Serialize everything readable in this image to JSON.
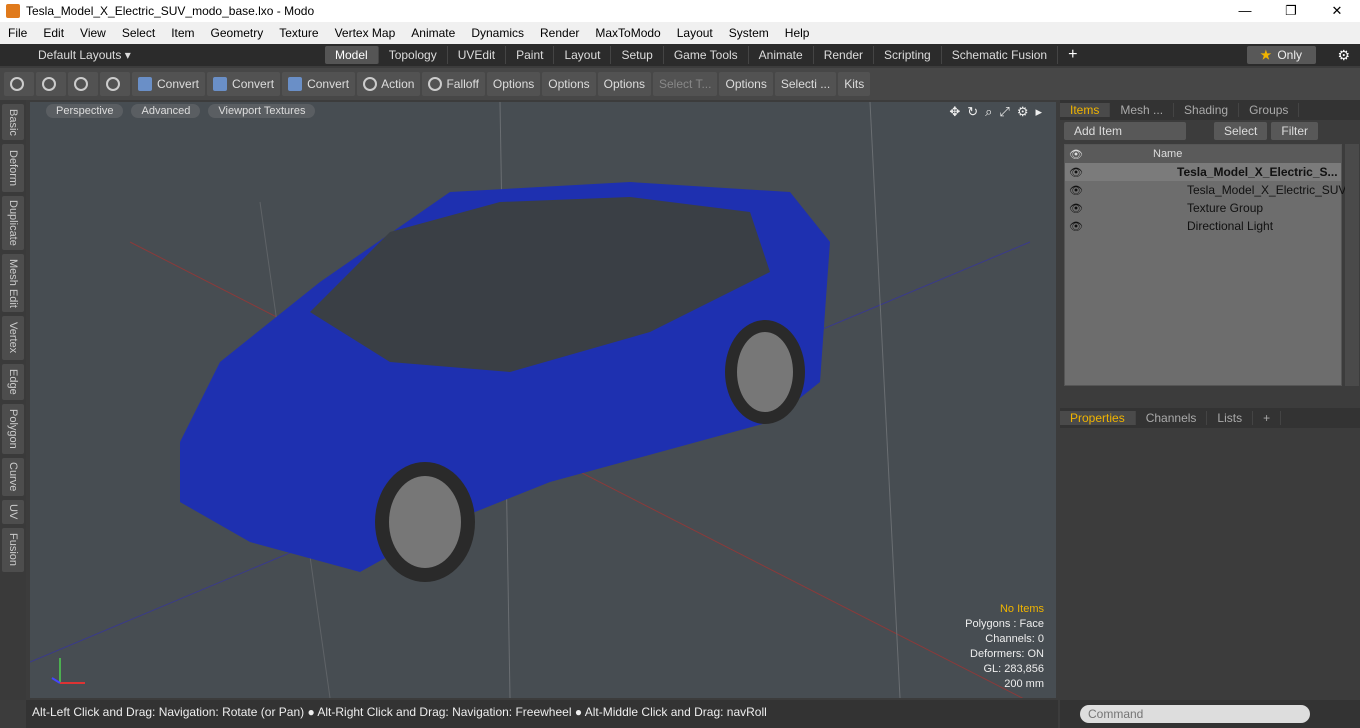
{
  "window": {
    "title": "Tesla_Model_X_Electric_SUV_modo_base.lxo - Modo",
    "minimize": "—",
    "maximize": "❐",
    "close": "✕"
  },
  "menu": [
    "File",
    "Edit",
    "View",
    "Select",
    "Item",
    "Geometry",
    "Texture",
    "Vertex Map",
    "Animate",
    "Dynamics",
    "Render",
    "MaxToModo",
    "Layout",
    "System",
    "Help"
  ],
  "layouts": {
    "label": "Default Layouts ▾"
  },
  "tabs": [
    {
      "label": "Model",
      "active": true
    },
    {
      "label": "Topology"
    },
    {
      "label": "UVEdit"
    },
    {
      "label": "Paint"
    },
    {
      "label": "Layout"
    },
    {
      "label": "Setup"
    },
    {
      "label": "Game Tools"
    },
    {
      "label": "Animate"
    },
    {
      "label": "Render"
    },
    {
      "label": "Scripting"
    },
    {
      "label": "Schematic Fusion"
    }
  ],
  "tab_plus": "+",
  "only": {
    "star": "★",
    "label": "Only"
  },
  "gear": "⚙",
  "toolbar": {
    "convert1": "Convert",
    "convert2": "Convert",
    "convert3": "Convert",
    "action": "Action",
    "falloff": "Falloff",
    "options1": "Options",
    "options2": "Options",
    "options3": "Options",
    "select_through": "Select T...",
    "options4": "Options",
    "selection": "Selecti ...",
    "kits": "Kits"
  },
  "left_tabs": [
    "Basic",
    "Deform",
    "Duplicate",
    "Mesh Edit",
    "Vertex",
    "Edge",
    "Polygon",
    "Curve",
    "UV",
    "Fusion"
  ],
  "viewport": {
    "buttons": [
      "Perspective",
      "Advanced",
      "Viewport Textures"
    ],
    "icons": [
      "✥",
      "↻",
      "⌕",
      "⤢",
      "⚙",
      "▸"
    ],
    "info": {
      "no_items": "No Items",
      "polygons": "Polygons : Face",
      "channels": "Channels: 0",
      "deformers": "Deformers: ON",
      "gl": "GL: 283,856",
      "scale": "200 mm"
    }
  },
  "status": "Alt-Left Click and Drag: Navigation: Rotate (or Pan) ● Alt-Right Click and Drag: Navigation: Freewheel ● Alt-Middle Click and Drag: navRoll",
  "items_panel": {
    "tabs": [
      {
        "label": "Items",
        "active": true
      },
      {
        "label": "Mesh ..."
      },
      {
        "label": "Shading"
      },
      {
        "label": "Groups"
      }
    ],
    "add_item": "Add Item",
    "select": "Select",
    "filter": "Filter",
    "header_name": "Name",
    "rows": [
      {
        "name": "Tesla_Model_X_Electric_S...",
        "bold": true
      },
      {
        "name": "Tesla_Model_X_Electric_SUV ..."
      },
      {
        "name": "Texture Group"
      },
      {
        "name": "Directional Light"
      }
    ]
  },
  "properties_panel": {
    "tabs": [
      {
        "label": "Properties",
        "active": true
      },
      {
        "label": "Channels"
      },
      {
        "label": "Lists"
      },
      {
        "label": "+"
      }
    ]
  },
  "command": {
    "placeholder": "Command"
  }
}
